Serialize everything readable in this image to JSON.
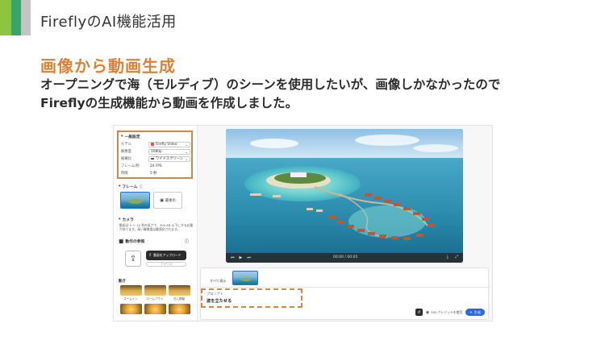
{
  "slide": {
    "accent_colors": [
      "#8cc63f",
      "#3aa56a",
      "#b7b7b7"
    ],
    "header_title": "FireflyのAI機能活用",
    "heading": "画像から動画生成",
    "description_line1": "オープニングで海（モルディブ）のシーンを使用したいが、画像しかなかったので",
    "description_line2": "Fireflyの生成機能から動画を作成しました。",
    "heading_color": "#d9823a"
  },
  "app": {
    "general": {
      "title": "一般設定",
      "rows": [
        {
          "label": "モデル",
          "value": "Firefly Video"
        },
        {
          "label": "解像度",
          "value": "1080p"
        },
        {
          "label": "縦横比",
          "value": "ワイドスクリーン"
        },
        {
          "label": "フレーム/秒",
          "value": "24 FPS"
        },
        {
          "label": "時間",
          "value": "5 秒"
        }
      ]
    },
    "frames": {
      "title": "フレーム",
      "end_label": "最後の"
    },
    "camera": {
      "title": "カメラ",
      "text": "動画は 5 〜 10 秒の長さで、300 KB 以下にする必要があります。高い解像度は最適化されます。"
    },
    "reference": {
      "title": "動作の参照",
      "upload_label": "動画をアップロード",
      "generate_label": "ブラウズ"
    },
    "motion": {
      "title": "動き",
      "items": [
        "ズームイン",
        "ズームアウト",
        "左に移動",
        "",
        "",
        ""
      ]
    },
    "video": {
      "time": "00:00 / 00:05"
    },
    "bottom": {
      "all_label": "すべて表示",
      "prompt_label": "プロンプト",
      "prompt_value": "波を立たせる",
      "credits": "500 クレジットを使用",
      "generate": "生成"
    },
    "brand_blue": "#2b6be0",
    "highlight_color": "#c98a4b"
  }
}
